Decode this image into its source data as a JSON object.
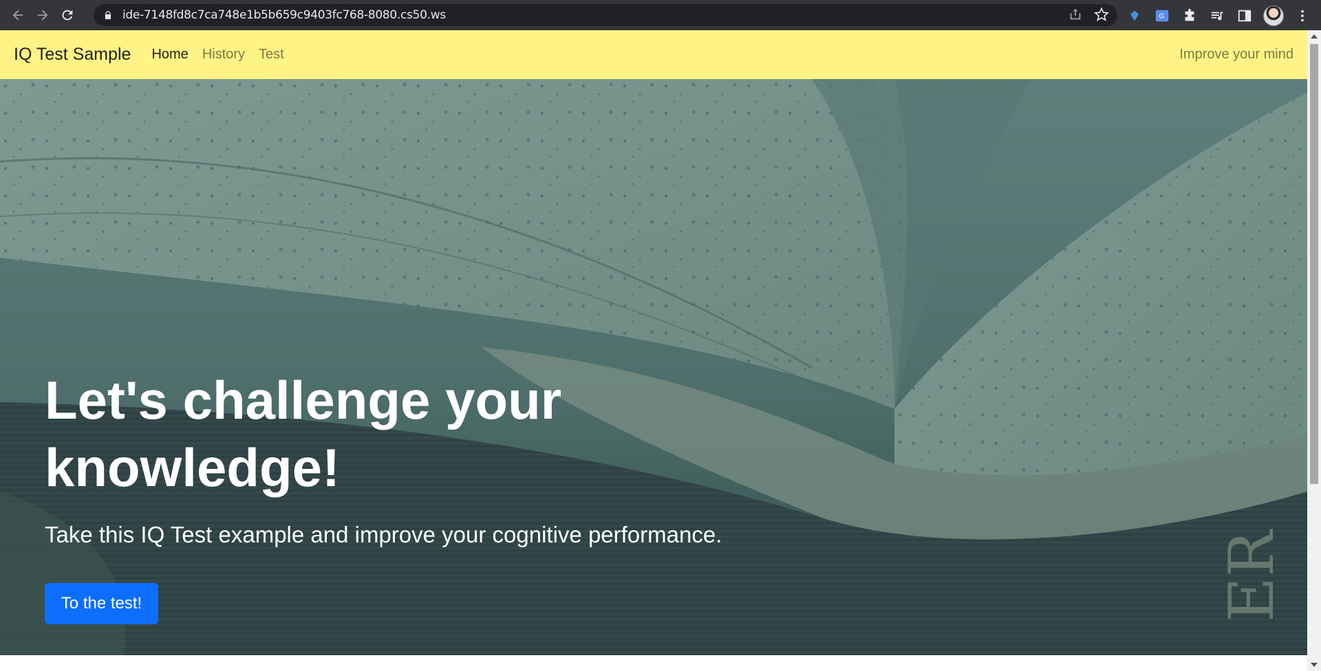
{
  "browser": {
    "url": "ide-7148fd8c7ca748e1b5b659c9403fc768-8080.cs50.ws",
    "icons": [
      "back-icon",
      "forward-icon",
      "reload-icon",
      "lock-icon",
      "share-icon",
      "bookmark-star-icon",
      "extension-icon",
      "translate-icon",
      "puzzle-icon",
      "media-icon",
      "side-panel-icon",
      "profile-avatar",
      "kebab-menu-icon"
    ]
  },
  "navbar": {
    "brand": "IQ Test Sample",
    "links": [
      {
        "label": "Home",
        "active": true
      },
      {
        "label": "History",
        "active": false
      },
      {
        "label": "Test",
        "active": false
      }
    ],
    "tagline": "Improve your mind",
    "background": "#fff386"
  },
  "hero": {
    "title": "Let's challenge your knowledge!",
    "subtitle": "Take this IQ Test example and improve your cognitive performance.",
    "button_label": "To the test!",
    "button_color": "#0d6efd"
  }
}
